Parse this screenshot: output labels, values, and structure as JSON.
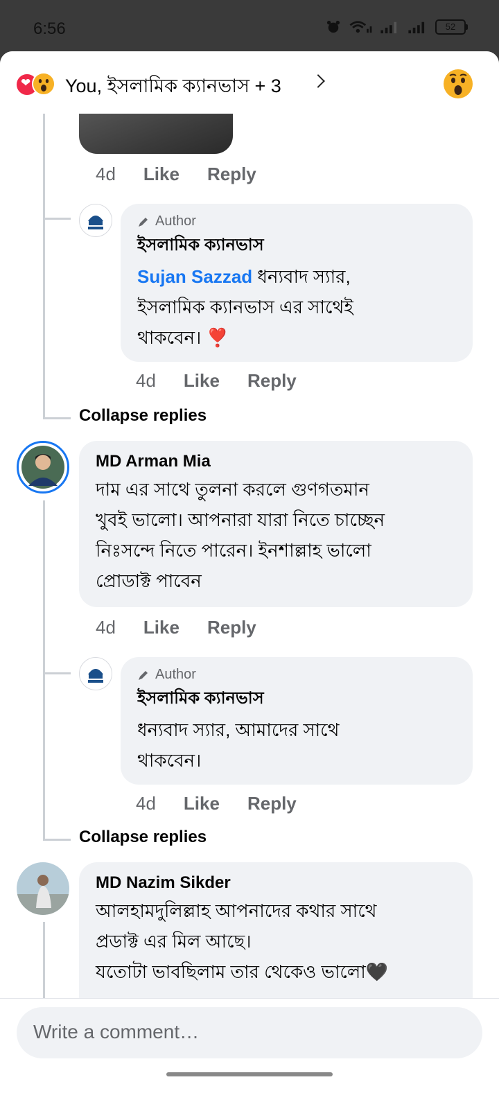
{
  "status_bar": {
    "time": "6:56",
    "battery": "52"
  },
  "reactions": {
    "summary": "You, ইসলামিক ক্যানভাস + 3"
  },
  "comments": [
    {
      "meta": {
        "time": "4d",
        "like": "Like",
        "reply": "Reply"
      }
    },
    {
      "badge": "Author",
      "name": "ইসলামিক ক্যানভাস",
      "mention": "Sujan Sazzad",
      "lines": [
        "ধন্যবাদ স্যার,",
        "ইসলামিক ক্যানভাস এর সাথেই",
        "থাকবেন। ❣️"
      ],
      "meta": {
        "time": "4d",
        "like": "Like",
        "reply": "Reply"
      }
    },
    {
      "name": "MD Arman Mia",
      "lines": [
        "দাম এর সাথে তুলনা করলে গুণগতমান",
        "খুবই ভালো। আপনারা যারা নিতে চাচ্ছেন",
        "নিঃসন্দে নিতে পারেন।  ইনশাল্লাহ ভালো",
        "প্রোডাক্ট পাবেন"
      ],
      "meta": {
        "time": "4d",
        "like": "Like",
        "reply": "Reply"
      }
    },
    {
      "badge": "Author",
      "name": "ইসলামিক ক্যানভাস",
      "lines": [
        "ধন্যবাদ স্যার,  আমাদের সাথে",
        "থাকবেন।"
      ],
      "meta": {
        "time": "4d",
        "like": "Like",
        "reply": "Reply"
      }
    },
    {
      "name": "MD Nazim Sikder",
      "lines": [
        "আলহামদুলিল্লাহ  আপনাদের কথার সাথে",
        "প্রডাক্ট এর মিল আছে।",
        "যতোটা ভাবছিলাম তার থেকেও ভালো🖤"
      ]
    }
  ],
  "collapse_label": "Collapse replies",
  "composer": {
    "placeholder": "Write a comment…"
  }
}
